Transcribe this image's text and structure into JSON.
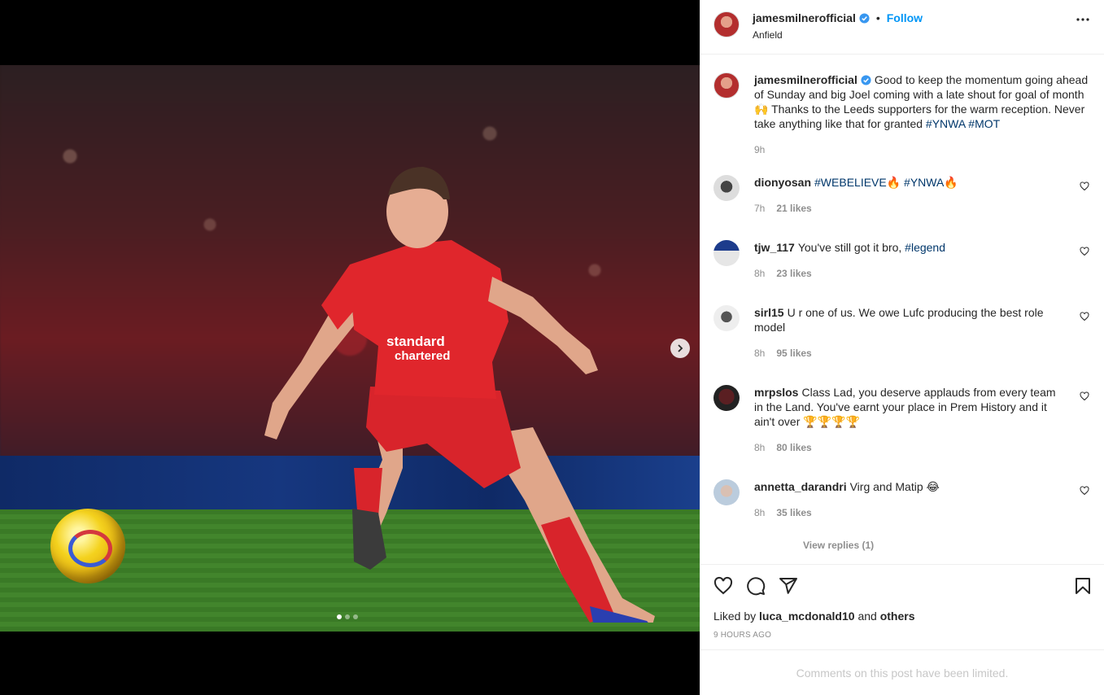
{
  "header": {
    "username": "jamesmilnerofficial",
    "follow_label": "Follow",
    "bullet": "•",
    "location": "Anfield"
  },
  "caption": {
    "username": "jamesmilnerofficial",
    "text": "Good to keep the momentum going ahead of Sunday and big Joel coming with a late shout for goal of month 🙌 Thanks to the Leeds supporters for the warm reception. Never take anything like that for granted",
    "tags": "#YNWA #MOT",
    "time": "9h"
  },
  "comments": [
    {
      "username": "dionyosan",
      "text": "",
      "tags": "#WEBELIEVE🔥 #YNWA🔥",
      "time": "7h",
      "likes": "21 likes"
    },
    {
      "username": "tjw_117",
      "text": "You've still got it bro,",
      "tags": "#legend",
      "time": "8h",
      "likes": "23 likes"
    },
    {
      "username": "sirl15",
      "text": "U r one of us. We owe Lufc producing the best role model",
      "tags": "",
      "time": "8h",
      "likes": "95 likes"
    },
    {
      "username": "mrpslos",
      "text": "Class Lad, you deserve applauds from every team in the Land. You've earnt your place in Prem History and it ain't over 🏆🏆🏆🏆",
      "tags": "",
      "time": "8h",
      "likes": "80 likes"
    },
    {
      "username": "annetta_darandri",
      "text": "Virg and Matip 😂",
      "tags": "",
      "time": "8h",
      "likes": "35 likes"
    }
  ],
  "view_replies": "View replies (1)",
  "liked_by": {
    "prefix": "Liked by",
    "user": "luca_mcdonald10",
    "and": "and",
    "others": "others"
  },
  "post_time": "9 HOURS AGO",
  "limited_notice": "Comments on this post have been limited.",
  "colors": {
    "accent": "#0095f6",
    "hashtag": "#00376b",
    "muted": "#8e8e8e"
  },
  "icons": {
    "more": "more-options-icon",
    "like": "heart-icon",
    "comment": "comment-icon",
    "share": "share-icon",
    "save": "bookmark-icon",
    "next": "chevron-right-icon",
    "verified": "verified-badge-icon"
  },
  "carousel": {
    "total": 3,
    "active": 1
  }
}
